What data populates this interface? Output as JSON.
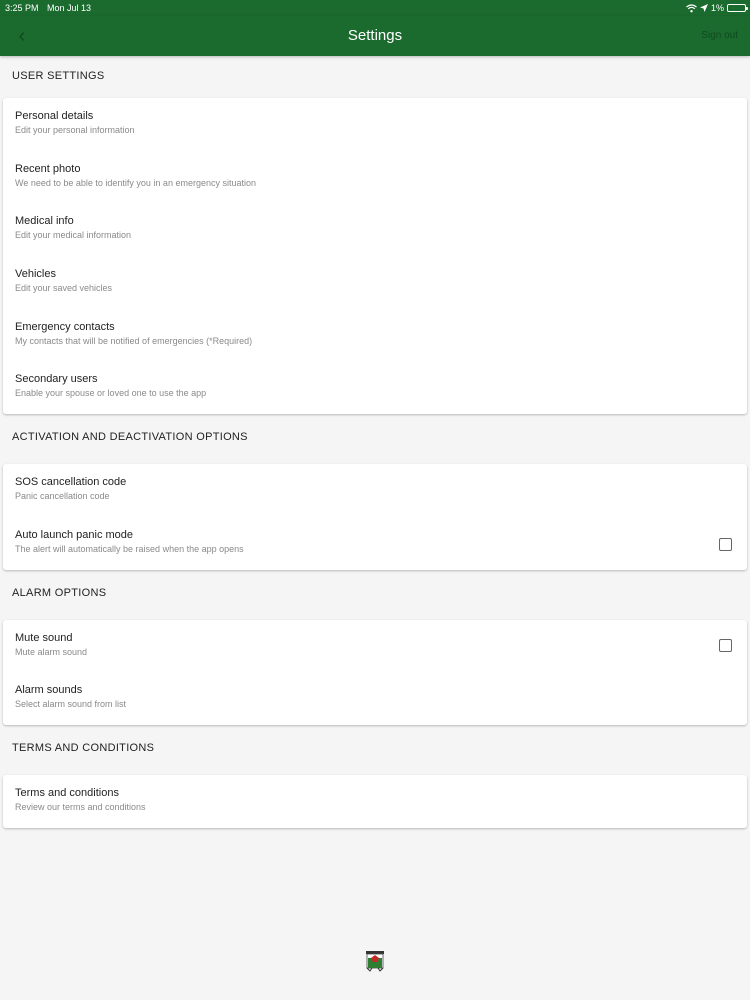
{
  "status": {
    "time": "3:25 PM",
    "date": "Mon Jul 13",
    "battery": "1%"
  },
  "appbar": {
    "title": "Settings",
    "signout": "Sign out"
  },
  "sections": [
    {
      "header": "USER SETTINGS",
      "items": [
        {
          "title": "Personal details",
          "sub": "Edit your personal information"
        },
        {
          "title": "Recent photo",
          "sub": "We need to be able to identify you in an emergency situation"
        },
        {
          "title": "Medical info",
          "sub": "Edit your medical information"
        },
        {
          "title": "Vehicles",
          "sub": "Edit your saved vehicles"
        },
        {
          "title": "Emergency contacts",
          "sub": "My contacts that will be notified of emergencies (*Required)"
        },
        {
          "title": "Secondary users",
          "sub": "Enable your spouse or loved one to use the app"
        }
      ]
    },
    {
      "header": "ACTIVATION AND DEACTIVATION OPTIONS",
      "items": [
        {
          "title": "SOS cancellation code",
          "sub": "Panic cancellation code"
        },
        {
          "title": "Auto launch panic mode",
          "sub": "The alert will automatically be raised when the app opens"
        }
      ]
    },
    {
      "header": "ALARM OPTIONS",
      "items": [
        {
          "title": "Mute sound",
          "sub": "Mute alarm sound"
        },
        {
          "title": "Alarm sounds",
          "sub": "Select alarm sound from list"
        }
      ]
    },
    {
      "header": "TERMS AND CONDITIONS",
      "items": [
        {
          "title": "Terms and conditions",
          "sub": "Review our terms and conditions"
        }
      ]
    }
  ],
  "colors": {
    "appbar": "#1b6b2f",
    "background": "#f5f5f5"
  },
  "icons": {
    "back": "back-chevron-icon",
    "wifi": "wifi-icon",
    "location": "location-arrow-icon",
    "battery": "battery-icon",
    "logo": "app-logo-icon"
  }
}
